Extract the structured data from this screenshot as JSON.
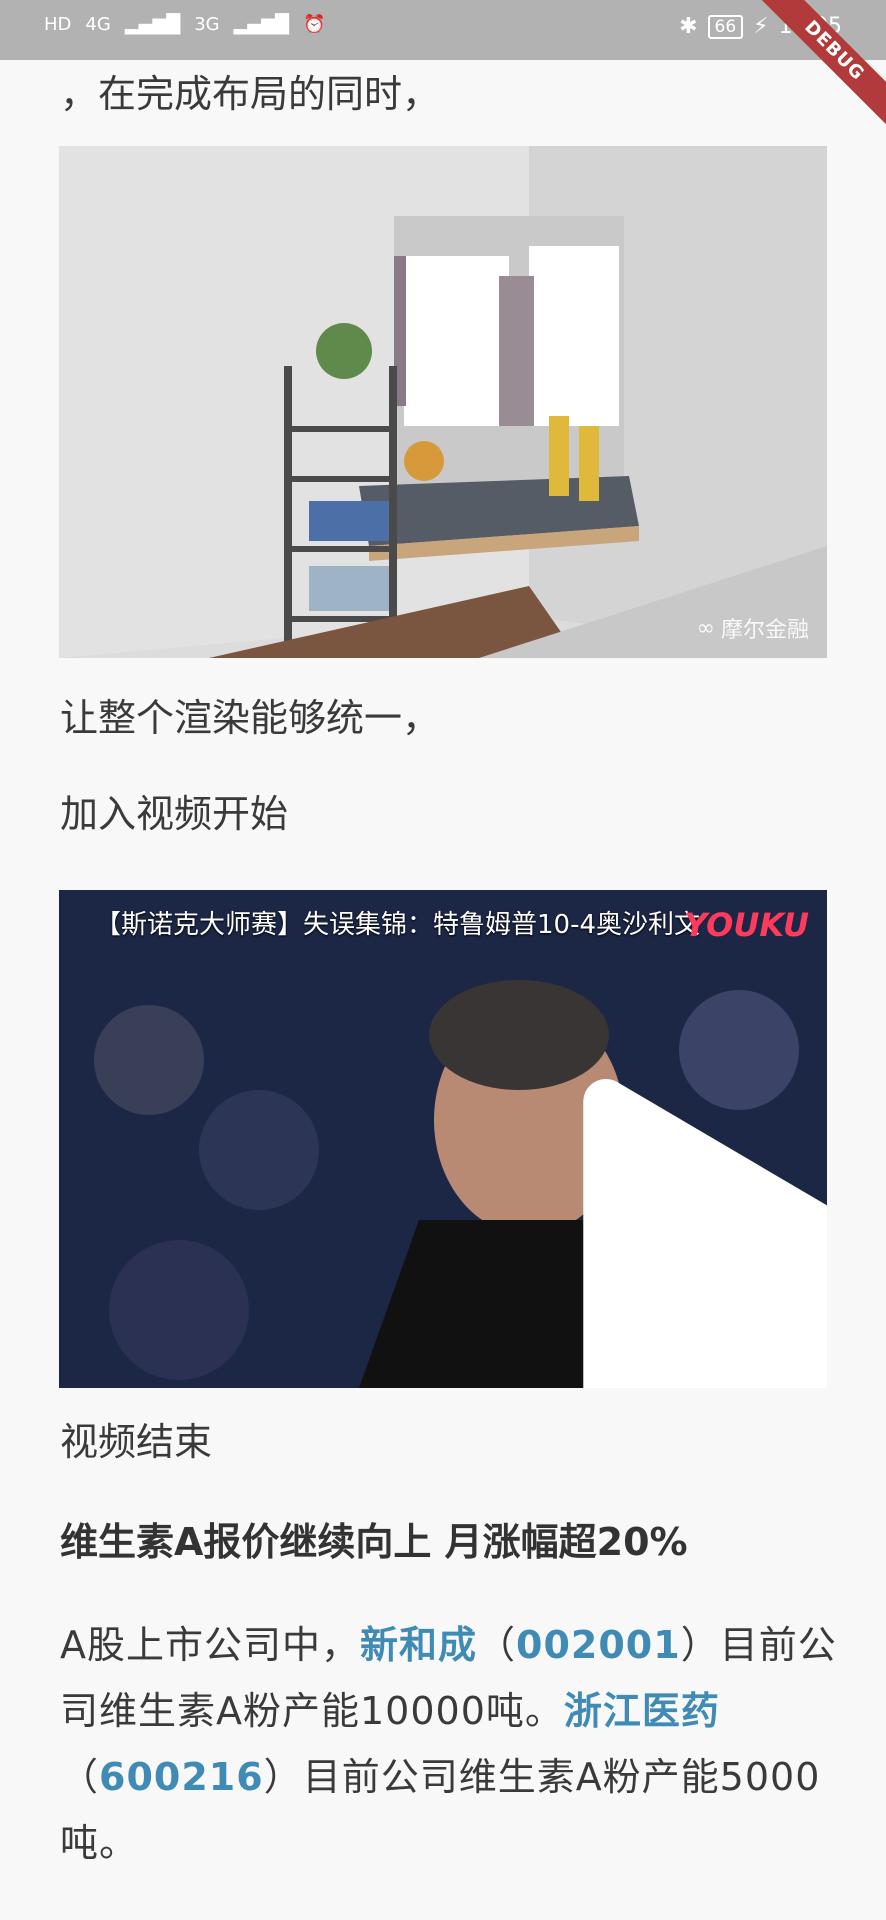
{
  "status_bar": {
    "left_indicators": [
      "HD",
      "4G",
      "3G"
    ],
    "battery": "66",
    "time": "10:05",
    "debug_label": "DEBUG"
  },
  "article": {
    "line1": "，在完成布局的同时，",
    "room_image": {
      "watermark": "摩尔金融"
    },
    "line2": "让整个渲染能够统一，",
    "line3": "加入视频开始",
    "video": {
      "title": "【斯诺克大师赛】失误集锦：特鲁姆普10-4奥沙利文",
      "logo": "YOUKU"
    },
    "line4": "视频结束",
    "heading": "维生素A报价继续向上 月涨幅超20%",
    "body": {
      "p1": "A股上市公司中，",
      "company1": "新和成",
      "lparen1": "（",
      "code1": "002001",
      "rparen1": "）",
      "p2": "目前公司维生素A粉产能10000吨。",
      "company2": "浙江医药",
      "lparen2": "（",
      "code2": "600216",
      "rparen2": "）",
      "p3": "目前公司维生素A粉产能5000吨。"
    }
  }
}
